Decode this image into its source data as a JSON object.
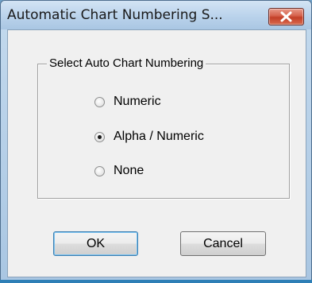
{
  "dialog": {
    "title": "Automatic Chart Numbering S...",
    "group_label": "Select Auto Chart Numbering",
    "options": [
      {
        "label": "Numeric",
        "selected": false
      },
      {
        "label": "Alpha / Numeric",
        "selected": true
      },
      {
        "label": "None",
        "selected": false
      }
    ],
    "ok_label": "OK",
    "cancel_label": "Cancel"
  },
  "colors": {
    "close_button": "#c33f27",
    "frame": "#a9c6e2",
    "client_bg": "#f0f0f0"
  },
  "icons": {
    "close": "close-icon"
  }
}
